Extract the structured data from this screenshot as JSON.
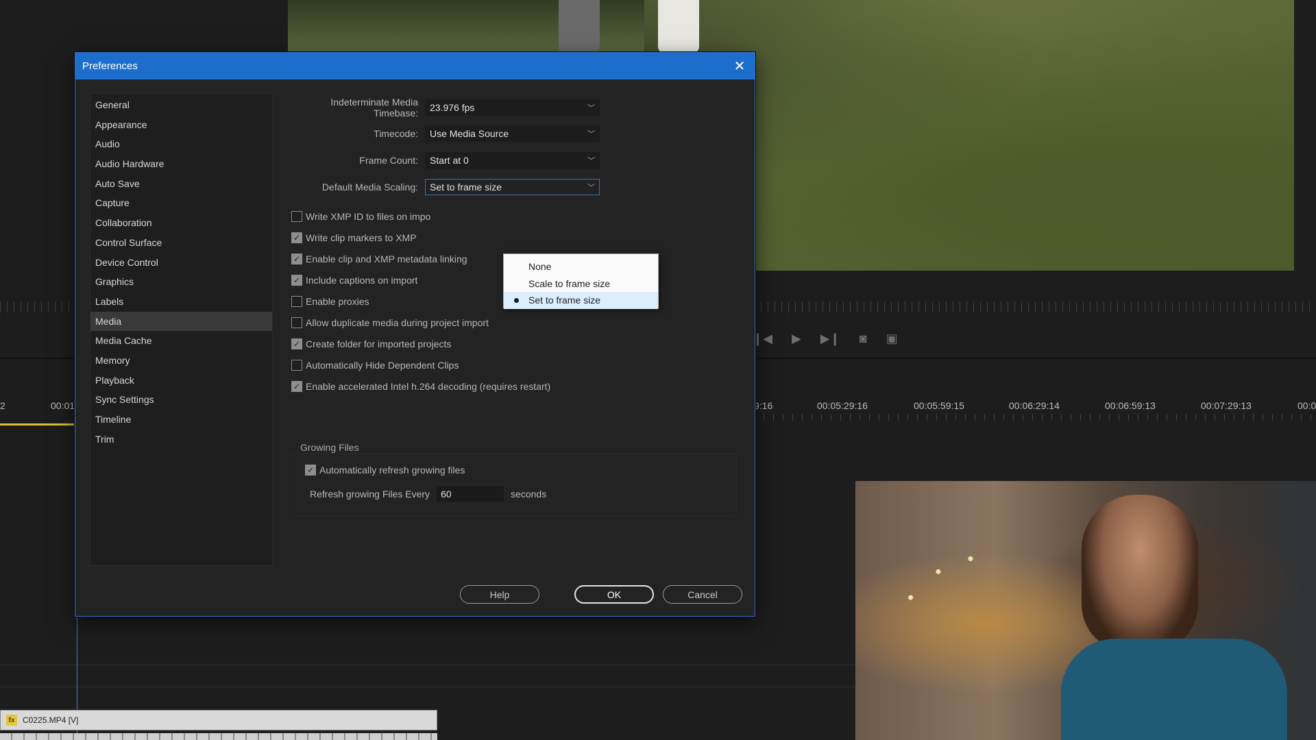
{
  "dialog": {
    "title": "Preferences",
    "close_icon": "close-icon"
  },
  "sidebar": {
    "items": [
      {
        "label": "General"
      },
      {
        "label": "Appearance"
      },
      {
        "label": "Audio"
      },
      {
        "label": "Audio Hardware"
      },
      {
        "label": "Auto Save"
      },
      {
        "label": "Capture"
      },
      {
        "label": "Collaboration"
      },
      {
        "label": "Control Surface"
      },
      {
        "label": "Device Control"
      },
      {
        "label": "Graphics"
      },
      {
        "label": "Labels"
      },
      {
        "label": "Media",
        "selected": true
      },
      {
        "label": "Media Cache"
      },
      {
        "label": "Memory"
      },
      {
        "label": "Playback"
      },
      {
        "label": "Sync Settings"
      },
      {
        "label": "Timeline"
      },
      {
        "label": "Trim"
      }
    ]
  },
  "settings": {
    "timebase": {
      "label": "Indeterminate Media Timebase:",
      "value": "23.976 fps"
    },
    "timecode": {
      "label": "Timecode:",
      "value": "Use Media Source"
    },
    "frame_count": {
      "label": "Frame Count:",
      "value": "Start at 0"
    },
    "scaling": {
      "label": "Default Media Scaling:",
      "value": "Set to frame size"
    }
  },
  "scaling_dropdown": {
    "options": [
      {
        "label": "None",
        "selected": false
      },
      {
        "label": "Scale to frame size",
        "selected": false
      },
      {
        "label": "Set to frame size",
        "selected": true
      }
    ]
  },
  "checkboxes": [
    {
      "label": "Write XMP ID to files on impo",
      "checked": false
    },
    {
      "label": "Write clip markers to XMP",
      "checked": true
    },
    {
      "label": "Enable clip and XMP metadata linking",
      "checked": true
    },
    {
      "label": "Include captions on import",
      "checked": true
    },
    {
      "label": "Enable proxies",
      "checked": false
    },
    {
      "label": "Allow duplicate media during project import",
      "checked": false
    },
    {
      "label": "Create folder for imported projects",
      "checked": true
    },
    {
      "label": "Automatically Hide Dependent Clips",
      "checked": false
    },
    {
      "label": "Enable accelerated Intel h.264 decoding (requires restart)",
      "checked": true
    }
  ],
  "growing_files": {
    "title": "Growing Files",
    "auto_refresh": {
      "label": "Automatically refresh growing files",
      "checked": true
    },
    "refresh_label": "Refresh growing Files Every",
    "refresh_value": "60",
    "refresh_unit": "seconds"
  },
  "buttons": {
    "help": "Help",
    "ok": "OK",
    "cancel": "Cancel"
  },
  "timeline": {
    "left_timecodes": [
      "2",
      "00:01"
    ],
    "timecodes": [
      "9:16",
      "00:05:29:16",
      "00:05:59:15",
      "00:06:29:14",
      "00:06:59:13",
      "00:07:29:13",
      "00:0"
    ],
    "clip_label": "C0225.MP4 [V]",
    "clip_fx": "fx"
  }
}
